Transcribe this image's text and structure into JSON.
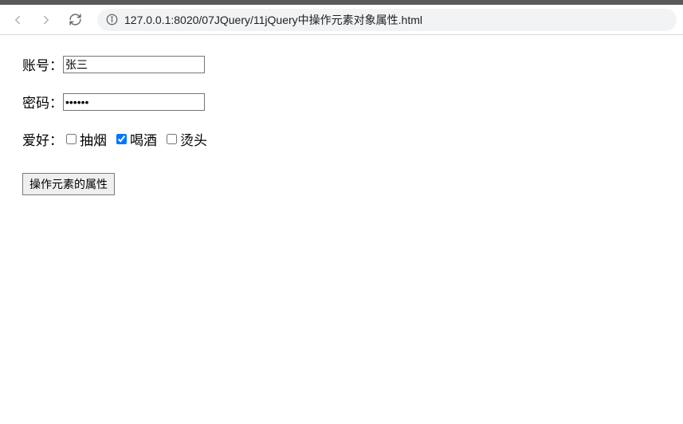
{
  "browser": {
    "url": "127.0.0.1:8020/07JQuery/11jQuery中操作元素对象属性.html"
  },
  "form": {
    "account_label": "账号：",
    "account_value": "张三",
    "password_label": "密码：",
    "password_value": "123456",
    "hobby_label": "爱好：",
    "hobbies": [
      {
        "label": "抽烟",
        "checked": false
      },
      {
        "label": "喝酒",
        "checked": true
      },
      {
        "label": "烫头",
        "checked": false
      }
    ],
    "button_label": "操作元素的属性"
  }
}
